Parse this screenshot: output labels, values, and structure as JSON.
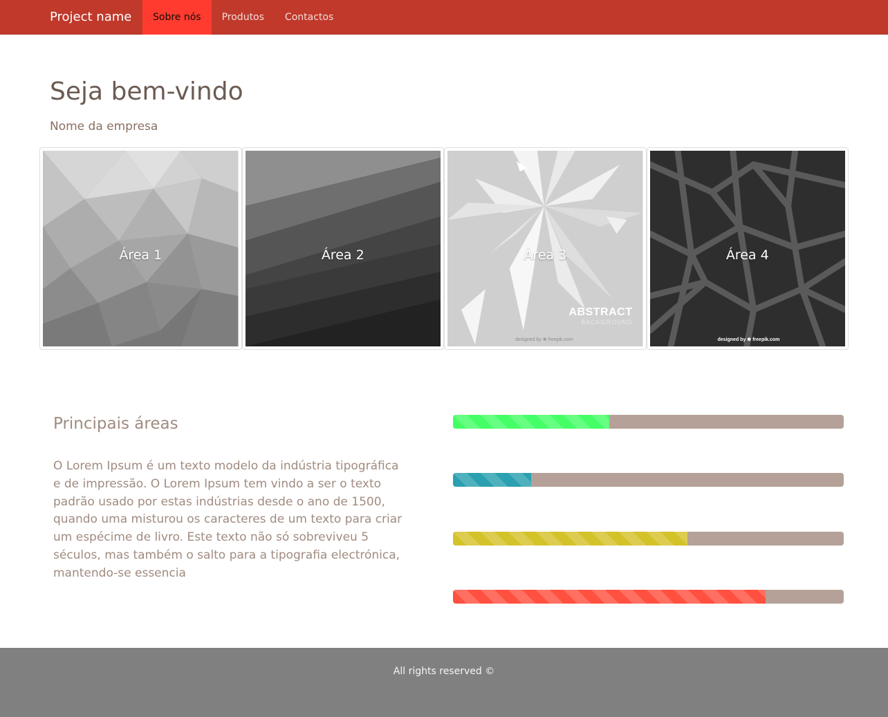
{
  "navbar": {
    "brand": "Project name",
    "items": [
      {
        "label": "Sobre nós",
        "active": true
      },
      {
        "label": "Produtos",
        "active": false
      },
      {
        "label": "Contactos",
        "active": false
      }
    ],
    "color": "#c0392b",
    "active_color": "#ff3b2f"
  },
  "hero": {
    "title": "Seja bem-vindo",
    "subtitle": "Nome da empresa"
  },
  "tiles": [
    {
      "label": "Área 1"
    },
    {
      "label": "Área 2"
    },
    {
      "label": "Área 3",
      "watermark_title": "ABSTRACT",
      "watermark_sub": "BACKGROUND",
      "credit": "designed by ❀ freepik.com"
    },
    {
      "label": "Área 4",
      "credit": "designed by ❀ freepik.com"
    }
  ],
  "areas": {
    "title": "Principais áreas",
    "text": "O Lorem Ipsum é um texto modelo da indústria tipográfica e de impressão. O Lorem Ipsum tem vindo a ser o texto padrão usado por estas indústrias desde o ano de 1500, quando uma misturou os caracteres de um texto para criar um espécime de livro. Este texto não só sobreviveu 5 séculos, mas também o salto para a tipografia electrónica, mantendo-se essencia"
  },
  "progress_bars": [
    {
      "value": 40,
      "color": "#44ff66"
    },
    {
      "value": 20,
      "color": "#2aa0b0"
    },
    {
      "value": 60,
      "color": "#d4c22a"
    },
    {
      "value": 80,
      "color": "#ff5040"
    }
  ],
  "footer": {
    "text": "All rights reserved ©"
  }
}
